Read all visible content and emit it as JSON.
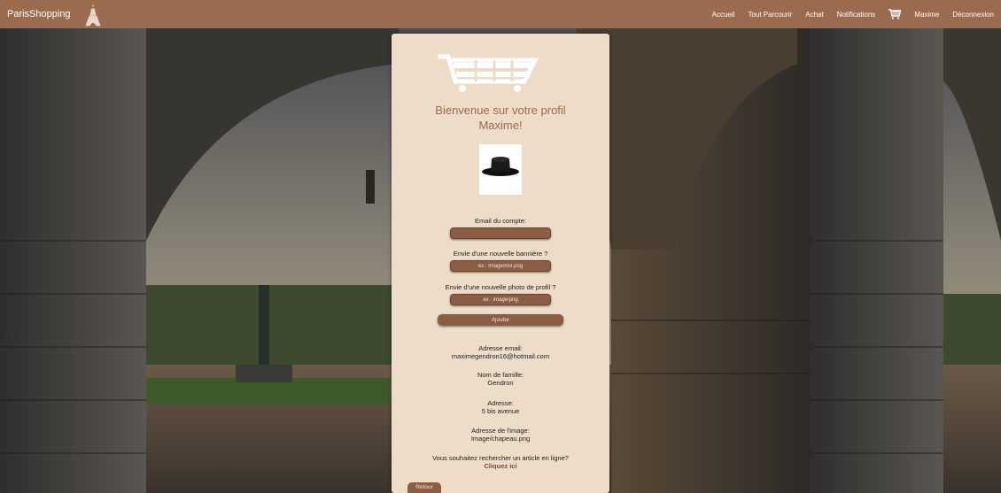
{
  "nav": {
    "brand": "ParisShopping",
    "links": [
      "Accueil",
      "Tout Parcourir",
      "Achat",
      "Notifications"
    ],
    "user": "Maxime",
    "logout": "Déconnexion"
  },
  "profile": {
    "welcome_line1": "Bienvenue sur votre profil",
    "welcome_line2": "Maxime!",
    "email_label": "Email du compte:",
    "email_value": "",
    "banner_label": "Envie d'une nouvelle bannière ?",
    "banner_placeholder": "ex : Image/xxx.png",
    "photo_label": "Envie d'une nouvelle photo de profil ?",
    "photo_placeholder": "ex : image/png",
    "add_button": "Ajouter",
    "info": [
      {
        "label": "Adresse email:",
        "value": "maximegendron16@hotmail.com"
      },
      {
        "label": "Nom de famille:",
        "value": "Gendron"
      },
      {
        "label": "Adresse:",
        "value": "5 bis avenue"
      },
      {
        "label": "Adresse de l'image:",
        "value": "Image/chapeau.png"
      }
    ],
    "search_prompt": "Vous souhaitez rechercher un article en ligne?",
    "search_link": "Cliquez ici",
    "back_button": "Retour"
  },
  "colors": {
    "navbar": "#9b6b50",
    "card": "#ecdcc8",
    "accent": "#8b5d45",
    "title": "#9b6b50"
  },
  "icons": [
    "eiffel-tower-icon",
    "cart-icon",
    "hat-avatar"
  ]
}
